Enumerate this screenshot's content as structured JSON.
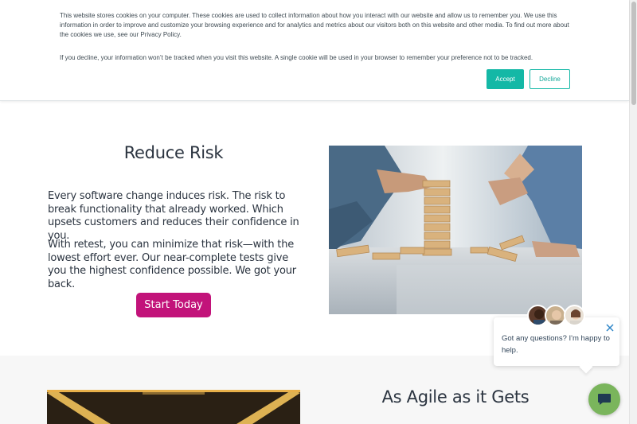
{
  "cookie_banner": {
    "paragraph1": "This website stores cookies on your computer. These cookies are used to collect information about how you interact with our website and allow us to remember you. We use this information in order to improve and customize your browsing experience and for analytics and metrics about our visitors both on this website and other media. To find out more about the cookies we use, see our Privacy Policy.",
    "paragraph2": "If you decline, your information won’t be tracked when you visit this website. A single cookie will be used in your browser to remember your preference not to be tracked.",
    "accept_label": "Accept",
    "decline_label": "Decline",
    "accent_color": "#14b8a6"
  },
  "reduce_risk": {
    "heading": "Reduce Risk",
    "paragraph1": "Every software change induces risk. The risk to break functionality that already worked. Which upsets customers and reduces their confidence in you.",
    "paragraph2": "With retest, you can minimize that risk—with the lowest effort ever. Our near-complete tests give you the highest confidence possible. We got your back.",
    "cta_label": "Start Today",
    "cta_color": "#c2137a",
    "image_icon": "jenga-tower-photo"
  },
  "agile": {
    "heading": "As Agile as it Gets",
    "image_icon": "tunnel-lights-photo"
  },
  "chat": {
    "message": "Got any questions? I'm happy to help.",
    "launcher_color": "#7ab55c",
    "close_icon": "close-icon"
  }
}
